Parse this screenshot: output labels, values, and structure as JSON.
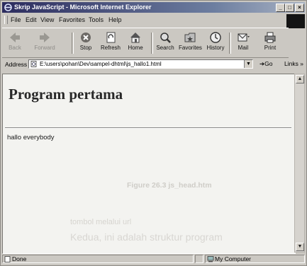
{
  "window": {
    "title": "Skrip JavaScript - Microsoft Internet Explorer"
  },
  "title_buttons": {
    "minimize": "_",
    "maximize": "□",
    "close": "×"
  },
  "menu": [
    "File",
    "Edit",
    "View",
    "Favorites",
    "Tools",
    "Help"
  ],
  "toolbar": {
    "back": "Back",
    "forward": "Forward",
    "stop": "Stop",
    "refresh": "Refresh",
    "home": "Home",
    "search": "Search",
    "favorites": "Favorites",
    "history": "History",
    "mail": "Mail",
    "print": "Print"
  },
  "address": {
    "label": "Address",
    "url": "E:\\users\\pohan\\Dev\\sampel-dhtml\\js_hallo1.html",
    "go": "Go",
    "links": "Links »"
  },
  "page": {
    "heading": "Program pertama",
    "body_text": "hallo everybody"
  },
  "background_bleed": {
    "line1": "Figure 26.3 js_head.htm",
    "line2": "tombol melalui url",
    "line3": "Kedua, ini adalah struktur program"
  },
  "status": {
    "text": "Done",
    "zone": "My Computer"
  },
  "colors": {
    "title_start": "#2c2c5e",
    "title_end": "#a9b3c3",
    "chrome": "#cbc8c2",
    "page_bg": "#f3f3f0"
  }
}
